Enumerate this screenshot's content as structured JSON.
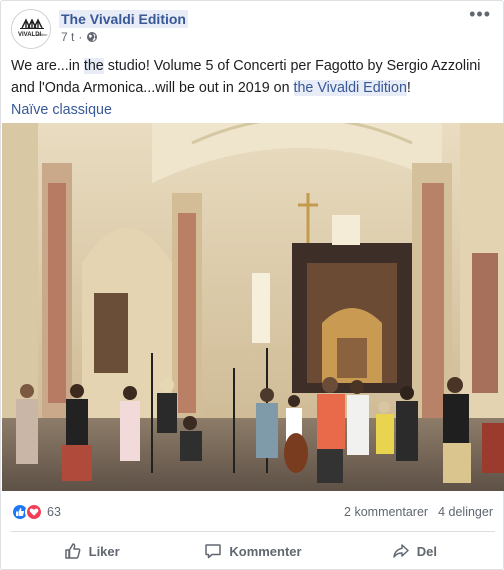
{
  "post": {
    "page_name": "The Vivaldi Edition",
    "avatar_text": "VIVALDI",
    "avatar_subtext": "edition",
    "time": "7 t",
    "separator": "·",
    "text_parts": {
      "p1": "We are...in ",
      "p2": "the",
      "p3": " studio! Volume 5 of Concerti per Fagotto by Sergio Azzolini and l'Onda Armonica...will be out in 2019 on ",
      "p4": "the Vivaldi Edition",
      "p5": "!"
    },
    "link": "Naïve classique"
  },
  "engagement": {
    "reaction_count": "63",
    "comments": "2 kommentarer",
    "shares": "4 delinger"
  },
  "actions": {
    "like": "Liker",
    "comment": "Kommenter",
    "share": "Del"
  },
  "icons": {
    "avatar": "vivaldi-logo",
    "privacy": "globe-icon",
    "menu": "more-icon",
    "like": "thumbs-up-icon",
    "comment": "speech-bubble-icon",
    "share": "share-arrow-icon"
  },
  "colors": {
    "link": "#385898",
    "like_reaction": "#2078f4",
    "love_reaction": "#f33e58",
    "muted_text": "#606770"
  }
}
